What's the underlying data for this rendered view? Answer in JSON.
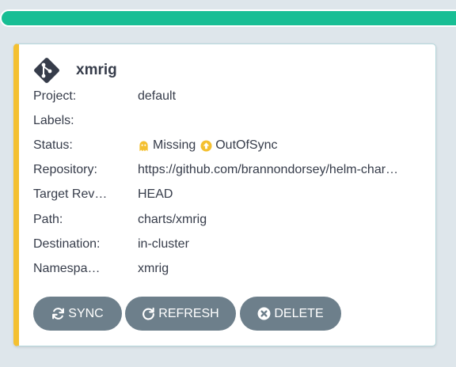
{
  "app": {
    "name": "xmrig",
    "fields": [
      {
        "key": "project",
        "label": "Project:",
        "value": "default"
      },
      {
        "key": "labels",
        "label": "Labels:",
        "value": ""
      },
      {
        "key": "status",
        "label": "Status:",
        "health": "Missing",
        "sync": "OutOfSync"
      },
      {
        "key": "repository",
        "label": "Repository:",
        "value": "https://github.com/brannondorsey/helm-char…"
      },
      {
        "key": "target_revision",
        "label": "Target Rev…",
        "value": "HEAD"
      },
      {
        "key": "path",
        "label": "Path:",
        "value": "charts/xmrig"
      },
      {
        "key": "destination",
        "label": "Destination:",
        "value": "in-cluster"
      },
      {
        "key": "namespace",
        "label": "Namespa…",
        "value": "xmrig"
      }
    ]
  },
  "actions": {
    "sync_label": "SYNC",
    "refresh_label": "REFRESH",
    "delete_label": "DELETE"
  },
  "icons": {
    "app": "git-icon",
    "health": "ghost-icon",
    "sync_status": "arrow-up-circle-icon",
    "sync_button": "sync-icon",
    "refresh_button": "refresh-icon",
    "delete_button": "times-circle-icon"
  },
  "colors": {
    "progress": "#18be94",
    "card_accent": "#f4c030",
    "status_icon": "#f4c030",
    "button_bg": "#6d7f8b",
    "text": "#363c4a"
  }
}
